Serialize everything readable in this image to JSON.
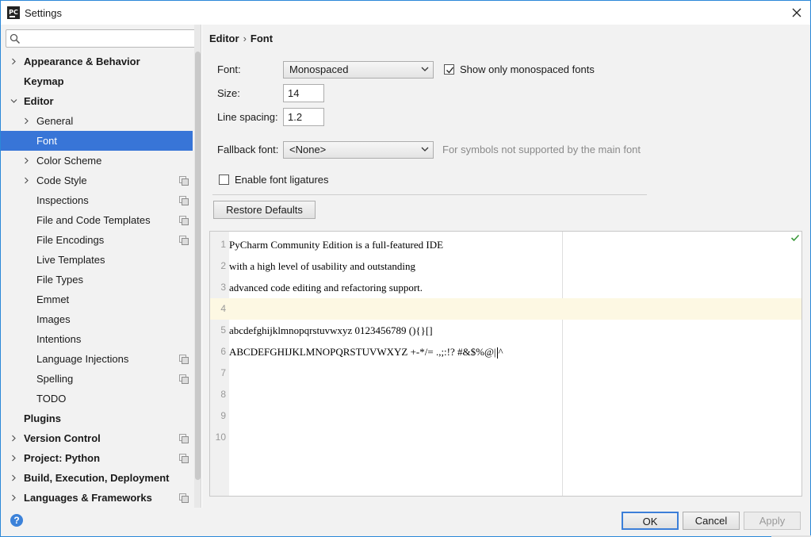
{
  "window": {
    "title": "Settings",
    "app_icon": "PC"
  },
  "search": {
    "value": "",
    "placeholder": ""
  },
  "sidebar": {
    "items": [
      {
        "label": "Appearance & Behavior",
        "bold": true,
        "expand": "collapsed",
        "level": 0,
        "copy": false
      },
      {
        "label": "Keymap",
        "bold": true,
        "expand": "none",
        "level": 0,
        "copy": false
      },
      {
        "label": "Editor",
        "bold": true,
        "expand": "expanded",
        "level": 0,
        "copy": false
      },
      {
        "label": "General",
        "bold": false,
        "expand": "collapsed",
        "level": 1,
        "copy": false
      },
      {
        "label": "Font",
        "bold": false,
        "expand": "none",
        "level": 1,
        "copy": false,
        "selected": true
      },
      {
        "label": "Color Scheme",
        "bold": false,
        "expand": "collapsed",
        "level": 1,
        "copy": false
      },
      {
        "label": "Code Style",
        "bold": false,
        "expand": "collapsed",
        "level": 1,
        "copy": true
      },
      {
        "label": "Inspections",
        "bold": false,
        "expand": "none",
        "level": 1,
        "copy": true
      },
      {
        "label": "File and Code Templates",
        "bold": false,
        "expand": "none",
        "level": 1,
        "copy": true
      },
      {
        "label": "File Encodings",
        "bold": false,
        "expand": "none",
        "level": 1,
        "copy": true
      },
      {
        "label": "Live Templates",
        "bold": false,
        "expand": "none",
        "level": 1,
        "copy": false
      },
      {
        "label": "File Types",
        "bold": false,
        "expand": "none",
        "level": 1,
        "copy": false
      },
      {
        "label": "Emmet",
        "bold": false,
        "expand": "none",
        "level": 1,
        "copy": false
      },
      {
        "label": "Images",
        "bold": false,
        "expand": "none",
        "level": 1,
        "copy": false
      },
      {
        "label": "Intentions",
        "bold": false,
        "expand": "none",
        "level": 1,
        "copy": false
      },
      {
        "label": "Language Injections",
        "bold": false,
        "expand": "none",
        "level": 1,
        "copy": true
      },
      {
        "label": "Spelling",
        "bold": false,
        "expand": "none",
        "level": 1,
        "copy": true
      },
      {
        "label": "TODO",
        "bold": false,
        "expand": "none",
        "level": 1,
        "copy": false
      },
      {
        "label": "Plugins",
        "bold": true,
        "expand": "none",
        "level": 0,
        "copy": false
      },
      {
        "label": "Version Control",
        "bold": true,
        "expand": "collapsed",
        "level": 0,
        "copy": true
      },
      {
        "label": "Project: Python",
        "bold": true,
        "expand": "collapsed",
        "level": 0,
        "copy": true
      },
      {
        "label": "Build, Execution, Deployment",
        "bold": true,
        "expand": "collapsed",
        "level": 0,
        "copy": false
      },
      {
        "label": "Languages & Frameworks",
        "bold": true,
        "expand": "collapsed",
        "level": 0,
        "copy": true
      }
    ]
  },
  "breadcrumb": {
    "parent": "Editor",
    "separator": "›",
    "current": "Font"
  },
  "font_form": {
    "font_label": "Font:",
    "font_value": "Monospaced",
    "monospaced_only_label": "Show only monospaced fonts",
    "monospaced_only_checked": true,
    "size_label": "Size:",
    "size_value": "14",
    "line_spacing_label": "Line spacing:",
    "line_spacing_value": "1.2",
    "fallback_label": "Fallback font:",
    "fallback_value": "<None>",
    "fallback_hint": "For symbols not supported by the main font",
    "ligatures_label": "Enable font ligatures",
    "ligatures_checked": false,
    "restore_label": "Restore Defaults"
  },
  "preview": {
    "lines": [
      {
        "no": "1",
        "text": "PyCharm Community Edition is a full-featured IDE"
      },
      {
        "no": "2",
        "text": "with a high level of usability and outstanding"
      },
      {
        "no": "3",
        "text": "advanced code editing and refactoring support."
      },
      {
        "no": "4",
        "text": "",
        "current": true
      },
      {
        "no": "5",
        "text": "abcdefghijklmnopqrstuvwxyz 0123456789 (){}[]"
      },
      {
        "no": "6",
        "text": "ABCDEFGHIJKLMNOPQRSTUVWXYZ +-*/= .,;:!? #&$%@|^"
      },
      {
        "no": "7",
        "text": ""
      },
      {
        "no": "8",
        "text": ""
      },
      {
        "no": "9",
        "text": ""
      },
      {
        "no": "10",
        "text": ""
      }
    ]
  },
  "footer": {
    "ok_label": "OK",
    "cancel_label": "Cancel",
    "apply_label": "Apply",
    "help_label": "?"
  },
  "colors": {
    "selection": "#3875d7",
    "accent": "#3c7fd8",
    "current_line": "#fdf8e3",
    "check": "#3c9a3c"
  }
}
